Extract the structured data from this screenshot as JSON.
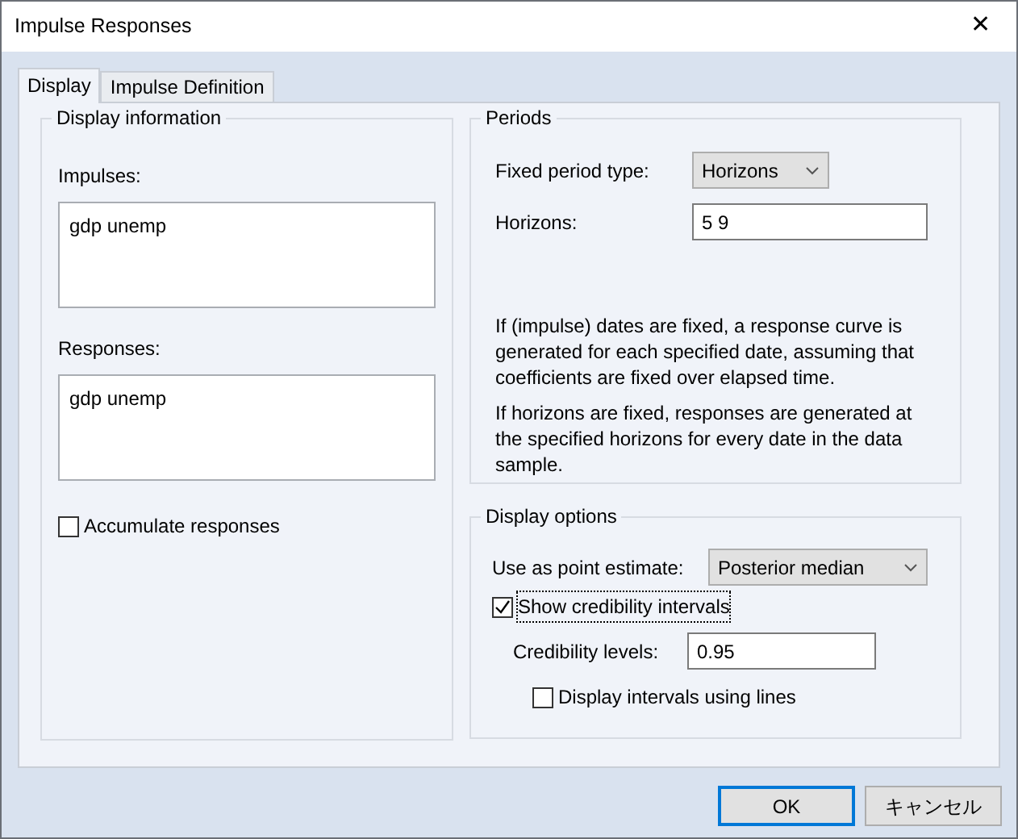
{
  "window": {
    "title": "Impulse Responses",
    "close": "✕"
  },
  "tabs": [
    {
      "label": "Display",
      "selected": true
    },
    {
      "label": "Impulse Definition",
      "selected": false
    }
  ],
  "display_information": {
    "title": "Display information",
    "impulses": {
      "label": "Impulses:",
      "value": "gdp unemp"
    },
    "responses": {
      "label": "Responses:",
      "value": "gdp unemp"
    },
    "accumulate": {
      "label": "Accumulate responses",
      "checked": false
    }
  },
  "periods": {
    "title": "Periods",
    "fixed_period_type": {
      "label": "Fixed period type:",
      "value": "Horizons"
    },
    "horizons": {
      "label": "Horizons:",
      "value": "5 9"
    },
    "notes": [
      "If (impulse) dates are fixed, a response curve is generated for each specified date, assuming that coefficients are fixed over elapsed time.",
      "If horizons are fixed, responses are generated at the specified horizons for every date in the data sample."
    ]
  },
  "display_options": {
    "title": "Display options",
    "point_estimate": {
      "label": "Use as point estimate:",
      "value": "Posterior median"
    },
    "show_intervals": {
      "label": "Show credibility intervals",
      "checked": true,
      "focused": true
    },
    "credibility_levels": {
      "label": "Credibility levels:",
      "value": "0.95"
    },
    "intervals_lines": {
      "label": "Display intervals using lines",
      "checked": false
    }
  },
  "buttons": [
    {
      "label": "OK",
      "default": true
    },
    {
      "label": "キャンセル",
      "default": false
    }
  ]
}
